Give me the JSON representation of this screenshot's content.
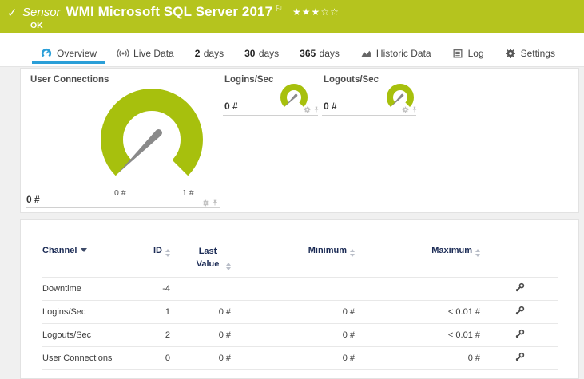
{
  "colors": {
    "header_bar": "#b5c41e",
    "gauge_green": "#a7c00d",
    "needle_gray": "#8a8a8a",
    "active_tab_blue": "#2b9fd8",
    "table_header_text": "#1b2b55"
  },
  "header": {
    "status_icon": "check-icon",
    "sensor_label": "Sensor",
    "title": "WMI Microsoft SQL Server 2017",
    "flag_icon": "flag-icon",
    "rating": {
      "filled": "★★★",
      "empty": "☆☆"
    },
    "status": "OK"
  },
  "tabs": [
    {
      "num": "",
      "label": "Overview",
      "icon": "gauge-icon",
      "active": true
    },
    {
      "num": "",
      "label": "Live Data",
      "icon": "broadcast-icon",
      "active": false
    },
    {
      "num": "2",
      "label": "days",
      "active": false
    },
    {
      "num": "30",
      "label": "days",
      "active": false
    },
    {
      "num": "365",
      "label": "days",
      "active": false
    },
    {
      "num": "",
      "label": "Historic Data",
      "icon": "chart-icon",
      "active": false
    },
    {
      "num": "",
      "label": "Log",
      "icon": "log-icon",
      "active": false
    },
    {
      "num": "",
      "label": "Settings",
      "icon": "gear-icon",
      "active": false
    }
  ],
  "gauges": {
    "primary": {
      "title": "User Connections",
      "value": "0 #",
      "scale_min": "0 #",
      "scale_max": "1 #"
    },
    "secondary": [
      {
        "title": "Logins/Sec",
        "value": "0 #"
      },
      {
        "title": "Logouts/Sec",
        "value": "0 #"
      }
    ]
  },
  "table": {
    "headers": {
      "channel": "Channel",
      "id": "ID",
      "last_value": "Last Value",
      "minimum": "Minimum",
      "maximum": "Maximum"
    },
    "rows": [
      {
        "channel": "Downtime",
        "id": "-4",
        "last": "",
        "min": "",
        "max": ""
      },
      {
        "channel": "Logins/Sec",
        "id": "1",
        "last": "0 #",
        "min": "0 #",
        "max": "< 0.01 #"
      },
      {
        "channel": "Logouts/Sec",
        "id": "2",
        "last": "0 #",
        "min": "0 #",
        "max": "< 0.01 #"
      },
      {
        "channel": "User Connections",
        "id": "0",
        "last": "0 #",
        "min": "0 #",
        "max": "0 #"
      }
    ]
  }
}
